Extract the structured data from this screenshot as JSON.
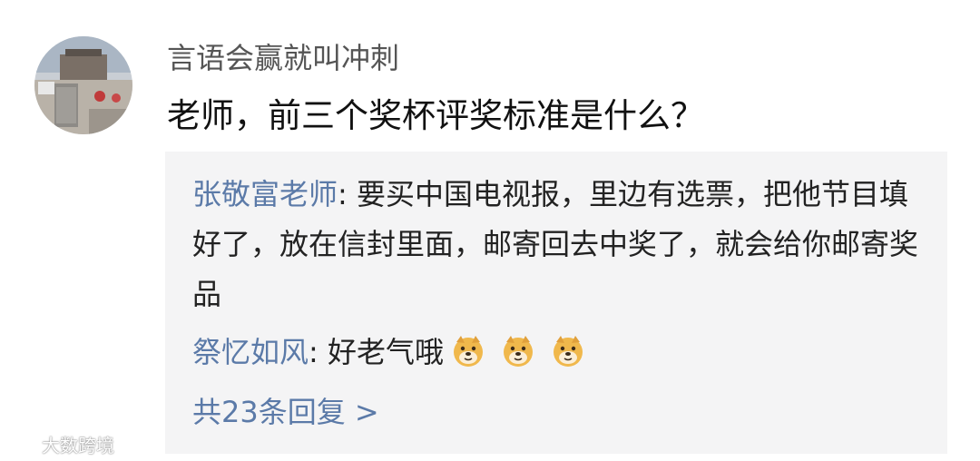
{
  "comment": {
    "username": "言语会赢就叫冲刺",
    "text": "老师，前三个奖杯评奖标准是什么？"
  },
  "replies": [
    {
      "user": "张敬富老师",
      "colon": ": ",
      "text": "要买中国电视报，里边有选票，把他节目填好了，放在信封里面，邮寄回去中奖了，就会给你邮寄奖品"
    },
    {
      "user": "祭忆如风",
      "colon": ": ",
      "text": "好老气哦",
      "emojis": [
        "doge-icon",
        "doge-icon",
        "doge-icon"
      ]
    }
  ],
  "more_replies": "共23条回复 >",
  "watermark": {
    "logo": "weibo-logo",
    "text": "大数跨境"
  },
  "colors": {
    "link": "#5b7aa8",
    "reply_bg": "#f4f4f5",
    "username": "#555555"
  }
}
